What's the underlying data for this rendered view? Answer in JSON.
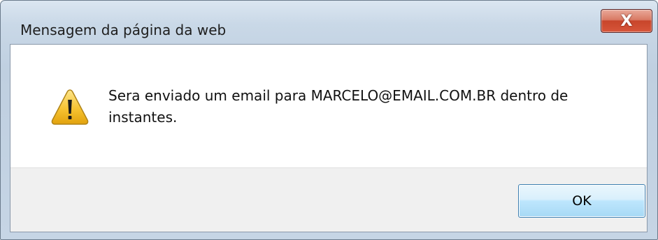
{
  "window": {
    "title": "Mensagem da página da web",
    "close_symbol": "X"
  },
  "dialog": {
    "icon": "warning-icon",
    "message": "Sera enviado um email para MARCELO@EMAIL.COM.BR dentro de instantes."
  },
  "buttons": {
    "ok_label": "OK"
  },
  "colors": {
    "warning_fill": "#f6c332",
    "close_button": "#c8452b",
    "ok_button_border": "#3c7fb1"
  }
}
